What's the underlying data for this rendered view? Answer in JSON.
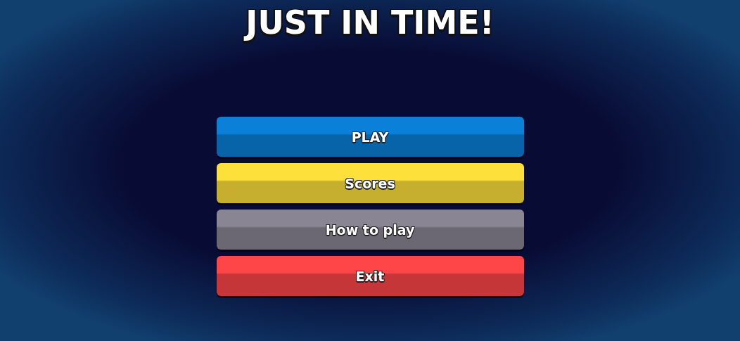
{
  "title": "JUST IN TIME!",
  "menu": [
    {
      "label": "PLAY",
      "color": "#0a80d8"
    },
    {
      "label": "Scores",
      "color": "#fde03a"
    },
    {
      "label": "How to play",
      "color": "#8a8592"
    },
    {
      "label": "Exit",
      "color": "#fe4649"
    }
  ]
}
